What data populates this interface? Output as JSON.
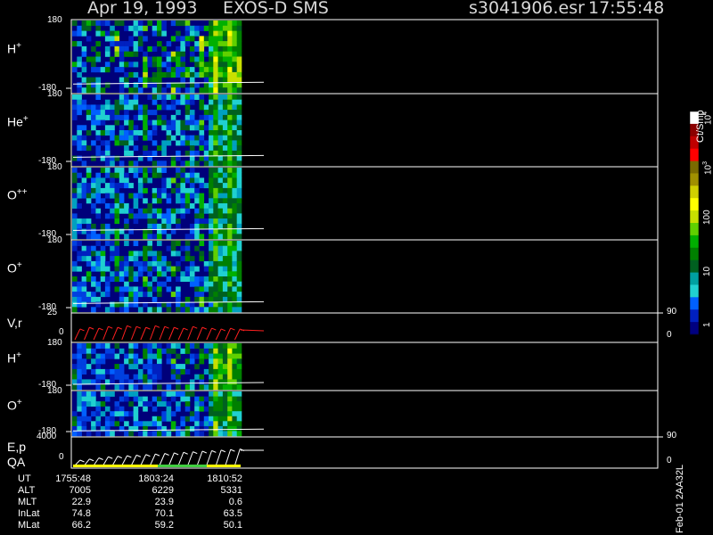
{
  "header": {
    "date": "Apr 19, 1993",
    "instrument": "EXOS-D SMS",
    "file": "s3041906.esr",
    "time": "17:55:48"
  },
  "colors": {
    "background": "#000000",
    "axis": "#ffffff",
    "velocity_trace": "#ff2020"
  },
  "icons": [
    "colorbar-icon"
  ],
  "chart_data": [
    {
      "type": "heatmap",
      "ylabel": "H",
      "ylabel_sup": "+",
      "ylim": [
        -180,
        180
      ],
      "ticks": [
        "180",
        "-180"
      ],
      "intensity": [
        0.35,
        0.55,
        0.45,
        0.6,
        0.4,
        0.65,
        0.5,
        0.7,
        0.55,
        0.75,
        0.85,
        0.95
      ]
    },
    {
      "type": "heatmap",
      "ylabel": "He",
      "ylabel_sup": "+",
      "ylim": [
        -180,
        180
      ],
      "ticks": [
        "180",
        "-180"
      ],
      "intensity": [
        0.25,
        0.35,
        0.3,
        0.4,
        0.3,
        0.45,
        0.35,
        0.4,
        0.4,
        0.5,
        0.55,
        0.6
      ]
    },
    {
      "type": "heatmap",
      "ylabel": "O",
      "ylabel_sup": "++",
      "ylim": [
        -180,
        180
      ],
      "ticks": [
        "180",
        "-180"
      ],
      "intensity": [
        0.25,
        0.35,
        0.3,
        0.4,
        0.3,
        0.45,
        0.35,
        0.45,
        0.4,
        0.5,
        0.55,
        0.6
      ]
    },
    {
      "type": "heatmap",
      "ylabel": "O",
      "ylabel_sup": "+",
      "ylim": [
        -180,
        180
      ],
      "ticks": [
        "180",
        "-180"
      ],
      "intensity": [
        0.25,
        0.35,
        0.3,
        0.4,
        0.3,
        0.45,
        0.35,
        0.45,
        0.4,
        0.5,
        0.55,
        0.6
      ]
    },
    {
      "type": "line",
      "ylabel": "V,r",
      "left_ticks": [
        "25",
        "0"
      ],
      "right_ticks": [
        "90",
        "0"
      ],
      "values": [
        12,
        14,
        13,
        15,
        14,
        16,
        15,
        14,
        16,
        15,
        14,
        13,
        15,
        14,
        13,
        12,
        13,
        12
      ]
    },
    {
      "type": "heatmap",
      "ylabel": "H",
      "ylabel_sup": "+",
      "ylim": [
        -180,
        180
      ],
      "ticks": [
        "180",
        "-180"
      ],
      "intensity": [
        0.2,
        0.2,
        0.2,
        0.2,
        0.2,
        0.3,
        0.45,
        0.5,
        0.45,
        0.55,
        0.8,
        0.9
      ]
    },
    {
      "type": "heatmap",
      "ylabel": "O",
      "ylabel_sup": "+",
      "ylim": [
        -180,
        180
      ],
      "ticks": [
        "180",
        "-180"
      ],
      "intensity": [
        0.2,
        0.25,
        0.2,
        0.25,
        0.2,
        0.3,
        0.3,
        0.35,
        0.35,
        0.45,
        0.6,
        0.7
      ]
    },
    {
      "type": "line",
      "ylabel": "E,p",
      "ylabel2": "QA",
      "left_ticks": [
        "4000",
        "0"
      ],
      "right_ticks": [
        "90",
        "0"
      ],
      "values": [
        800,
        1000,
        1200,
        1400,
        1500,
        1600,
        1700,
        1800,
        1900,
        2000,
        2100,
        2200,
        2300,
        2400,
        2500,
        2600,
        2700,
        2800
      ]
    }
  ],
  "colorbar": {
    "title": "Ct/Smp",
    "ticks": [
      "10",
      "10",
      "100",
      "10",
      "1"
    ],
    "tick_sups": [
      "4",
      "3",
      "",
      "",
      ""
    ],
    "stops": [
      "#ffffff",
      "#8b0000",
      "#c00000",
      "#ff0000",
      "#7a6a00",
      "#a09000",
      "#d0d000",
      "#ffff00",
      "#c8e000",
      "#60d000",
      "#00b000",
      "#008000",
      "#006020",
      "#00a0a0",
      "#20d0d0",
      "#0060ff",
      "#0020c0",
      "#000080"
    ]
  },
  "footer": {
    "rows": [
      {
        "label": "UT",
        "v1": "1755:48",
        "v2": "1803:24",
        "v3": "1810:52"
      },
      {
        "label": "ALT",
        "v1": "7005",
        "v2": "6229",
        "v3": "5331"
      },
      {
        "label": "MLT",
        "v1": "22.9",
        "v2": "23.9",
        "v3": "0.6"
      },
      {
        "label": "InLat",
        "v1": "74.8",
        "v2": "70.1",
        "v3": "63.5"
      },
      {
        "label": "MLat",
        "v1": "66.2",
        "v2": "59.2",
        "v3": "50.1"
      }
    ],
    "stamp": "Feb-01 2AA32L"
  }
}
